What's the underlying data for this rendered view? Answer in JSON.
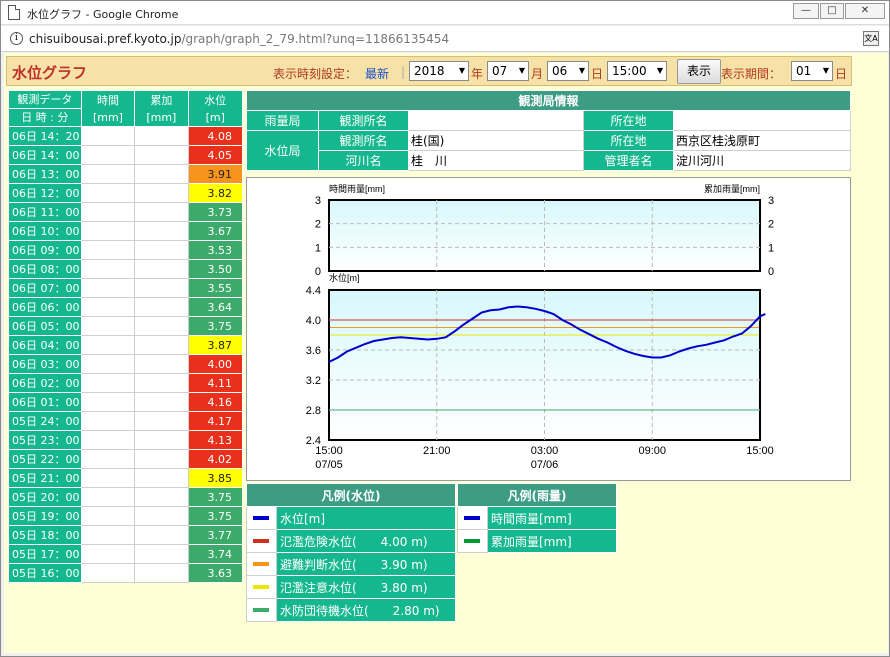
{
  "window": {
    "title": "水位グラフ - Google Chrome",
    "min": "—",
    "max": "□",
    "close": "✕"
  },
  "address": {
    "host": "chisuibousai.pref.kyoto.jp",
    "path": "/graph/graph_2_79.html?unq=11866135454",
    "translate": "文A"
  },
  "header": {
    "title": "水位グラフ",
    "time_label": "表示時刻設定：",
    "latest": "最新",
    "year": "2018",
    "year_unit": "年",
    "month": "07",
    "month_unit": "月",
    "day": "06",
    "day_unit": "日",
    "time": "15:00",
    "show_button": "表示",
    "period_label": "表示期間：",
    "period": "01",
    "period_unit": "日"
  },
  "obs_table": {
    "headers": {
      "obs": "観測データ",
      "date": "日 時 : 分",
      "hourly": "時間",
      "hourly_unit": "[mm]",
      "cumulative": "累加",
      "cumulative_unit": "[mm]",
      "level": "水位",
      "level_unit": "[m]"
    },
    "rows": [
      {
        "time": "06日 14：20",
        "level": "4.08",
        "color": "#e8301c"
      },
      {
        "time": "06日 14：00",
        "level": "4.05",
        "color": "#e8301c"
      },
      {
        "time": "06日 13：00",
        "level": "3.91",
        "color": "#f7941d"
      },
      {
        "time": "06日 12：00",
        "level": "3.82",
        "color": "#ffff00"
      },
      {
        "time": "06日 11：00",
        "level": "3.73",
        "color": "#3caa6a"
      },
      {
        "time": "06日 10：00",
        "level": "3.67",
        "color": "#3caa6a"
      },
      {
        "time": "06日 09：00",
        "level": "3.53",
        "color": "#3caa6a"
      },
      {
        "time": "06日 08：00",
        "level": "3.50",
        "color": "#3caa6a"
      },
      {
        "time": "06日 07：00",
        "level": "3.55",
        "color": "#3caa6a"
      },
      {
        "time": "06日 06：00",
        "level": "3.64",
        "color": "#3caa6a"
      },
      {
        "time": "06日 05：00",
        "level": "3.75",
        "color": "#3caa6a"
      },
      {
        "time": "06日 04：00",
        "level": "3.87",
        "color": "#ffff00"
      },
      {
        "time": "06日 03：00",
        "level": "4.00",
        "color": "#e8301c"
      },
      {
        "time": "06日 02：00",
        "level": "4.11",
        "color": "#e8301c"
      },
      {
        "time": "06日 01：00",
        "level": "4.16",
        "color": "#e8301c"
      },
      {
        "time": "05日 24：00",
        "level": "4.17",
        "color": "#e8301c"
      },
      {
        "time": "05日 23：00",
        "level": "4.13",
        "color": "#e8301c"
      },
      {
        "time": "05日 22：00",
        "level": "4.02",
        "color": "#e8301c"
      },
      {
        "time": "05日 21：00",
        "level": "3.85",
        "color": "#ffff00"
      },
      {
        "time": "05日 20：00",
        "level": "3.75",
        "color": "#3caa6a"
      },
      {
        "time": "05日 19：00",
        "level": "3.75",
        "color": "#3caa6a"
      },
      {
        "time": "05日 18：00",
        "level": "3.77",
        "color": "#3caa6a"
      },
      {
        "time": "05日 17：00",
        "level": "3.74",
        "color": "#3caa6a"
      },
      {
        "time": "05日 16：00",
        "level": "3.63",
        "color": "#3caa6a"
      }
    ]
  },
  "station": {
    "title": "観測局情報",
    "rain_station": "雨量局",
    "obs_name_label": "観測所名",
    "rain_obs_name": "",
    "location_label": "所在地",
    "rain_location": "",
    "level_station": "水位局",
    "level_obs_name": "桂(国)",
    "level_location": "西京区桂浅原町",
    "river_label": "河川名",
    "river": "桂　川",
    "manager_label": "管理者名",
    "manager": "淀川河川"
  },
  "chart_data": [
    {
      "type": "line",
      "ylabel_left": "時間雨量[mm]",
      "ylabel_right": "累加雨量[mm]",
      "ylim": [
        0,
        3
      ],
      "yticks": [
        "0",
        "1",
        "2",
        "3"
      ],
      "series": []
    },
    {
      "type": "line",
      "ylabel": "水位[m]",
      "ylim": [
        2.4,
        4.4
      ],
      "yticks": [
        "2.4",
        "2.8",
        "3.2",
        "3.6",
        "4.0",
        "4.4"
      ],
      "xlim": [
        0,
        24
      ],
      "xticks": [
        {
          "v": 0,
          "label": "15:00",
          "sub": "07/05"
        },
        {
          "v": 6,
          "label": "21:00",
          "sub": ""
        },
        {
          "v": 12,
          "label": "03:00",
          "sub": "07/06"
        },
        {
          "v": 18,
          "label": "09:00",
          "sub": ""
        },
        {
          "v": 24,
          "label": "15:00",
          "sub": ""
        }
      ],
      "thresholds": [
        {
          "value": 4.0,
          "color": "#d03020"
        },
        {
          "value": 3.9,
          "color": "#f7941d"
        },
        {
          "value": 3.8,
          "color": "#e8e800"
        },
        {
          "value": 2.8,
          "color": "#3caa6a"
        }
      ],
      "points": [
        [
          0,
          3.44
        ],
        [
          0.5,
          3.5
        ],
        [
          1,
          3.58
        ],
        [
          1.5,
          3.63
        ],
        [
          2,
          3.68
        ],
        [
          2.5,
          3.72
        ],
        [
          3,
          3.74
        ],
        [
          3.5,
          3.76
        ],
        [
          4,
          3.77
        ],
        [
          4.5,
          3.76
        ],
        [
          5,
          3.75
        ],
        [
          5.5,
          3.74
        ],
        [
          6,
          3.75
        ],
        [
          6.5,
          3.77
        ],
        [
          7,
          3.85
        ],
        [
          7.5,
          3.94
        ],
        [
          8,
          4.02
        ],
        [
          8.5,
          4.1
        ],
        [
          9,
          4.13
        ],
        [
          9.5,
          4.14
        ],
        [
          10,
          4.17
        ],
        [
          10.5,
          4.18
        ],
        [
          11,
          4.17
        ],
        [
          11.5,
          4.15
        ],
        [
          12,
          4.12
        ],
        [
          12.5,
          4.08
        ],
        [
          13,
          4.0
        ],
        [
          13.5,
          3.94
        ],
        [
          14,
          3.87
        ],
        [
          14.5,
          3.81
        ],
        [
          15,
          3.75
        ],
        [
          15.5,
          3.7
        ],
        [
          16,
          3.64
        ],
        [
          16.5,
          3.59
        ],
        [
          17,
          3.55
        ],
        [
          17.5,
          3.52
        ],
        [
          18,
          3.5
        ],
        [
          18.5,
          3.5
        ],
        [
          19,
          3.53
        ],
        [
          19.5,
          3.58
        ],
        [
          20,
          3.62
        ],
        [
          20.5,
          3.65
        ],
        [
          21,
          3.67
        ],
        [
          21.5,
          3.7
        ],
        [
          22,
          3.73
        ],
        [
          22.5,
          3.78
        ],
        [
          23,
          3.82
        ],
        [
          23.5,
          3.92
        ],
        [
          24,
          4.05
        ],
        [
          24.3,
          4.08
        ]
      ]
    }
  ],
  "legend_level": {
    "title": "凡例(水位)",
    "items": [
      {
        "label": "水位[m]",
        "color": "#0000cc"
      },
      {
        "label": "氾濫危険水位(　　4.00 m)",
        "color": "#d03020"
      },
      {
        "label": "避難判断水位(　　3.90 m)",
        "color": "#f7941d"
      },
      {
        "label": "氾濫注意水位(　　3.80 m)",
        "color": "#e8e800"
      },
      {
        "label": "水防団待機水位(　　2.80 m)",
        "color": "#3caa6a"
      }
    ]
  },
  "legend_rain": {
    "title": "凡例(雨量)",
    "items": [
      {
        "label": "時間雨量[mm]",
        "color": "#0000cc"
      },
      {
        "label": "累加雨量[mm]",
        "color": "#009933"
      }
    ]
  }
}
